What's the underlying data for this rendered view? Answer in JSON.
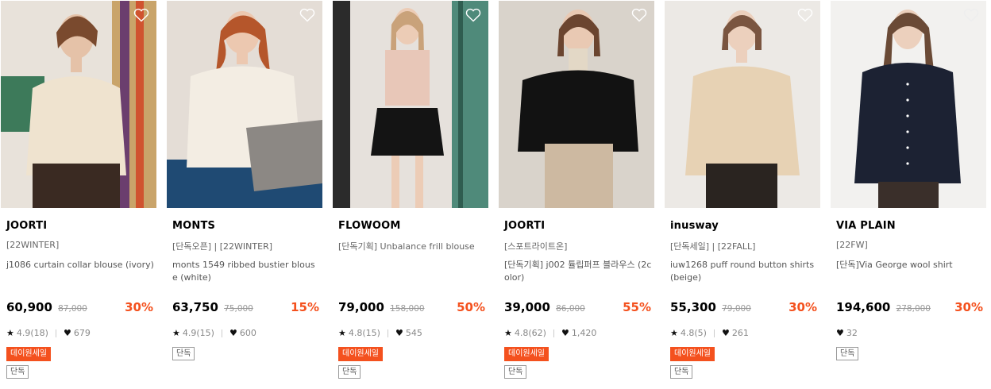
{
  "products": [
    {
      "brand": "JOORTI",
      "tag": "[22WINTER]",
      "name": "j1086 curtain collar blouse (ivory)",
      "price": "60,900",
      "original_price": "87,000",
      "discount": "30%",
      "rating": "4.9(18)",
      "likes": "679",
      "sale_badge": "데이원세일",
      "exclusive_badge": "단독"
    },
    {
      "brand": "MONTS",
      "tag": "[단독오픈] | [22WINTER]",
      "name": "monts 1549 ribbed bustier blouse (white)",
      "price": "63,750",
      "original_price": "75,000",
      "discount": "15%",
      "rating": "4.9(15)",
      "likes": "600",
      "exclusive_badge": "단독"
    },
    {
      "brand": "FLOWOOM",
      "tag": "[단독기획] Unbalance frill blouse",
      "name": "",
      "price": "79,000",
      "original_price": "158,000",
      "discount": "50%",
      "rating": "4.8(15)",
      "likes": "545",
      "sale_badge": "데이원세일",
      "exclusive_badge": "단독"
    },
    {
      "brand": "JOORTI",
      "tag": "[스포트라이트온]",
      "name": "[단독기획] j002 튤립퍼프 블라우스 (2color)",
      "price": "39,000",
      "original_price": "86,000",
      "discount": "55%",
      "rating": "4.8(62)",
      "likes": "1,420",
      "sale_badge": "데이원세일",
      "exclusive_badge": "단독"
    },
    {
      "brand": "inusway",
      "tag": "[단독세일] | [22FALL]",
      "name": "iuw1268 puff round button shirts (beige)",
      "price": "55,300",
      "original_price": "79,000",
      "discount": "30%",
      "rating": "4.8(5)",
      "likes": "261",
      "sale_badge": "데이원세일",
      "exclusive_badge": "단독"
    },
    {
      "brand": "VIA PLAIN",
      "tag": "[22FW]",
      "name": "[단독]Via George wool shirt",
      "price": "194,600",
      "original_price": "278,000",
      "discount": "30%",
      "rating": "",
      "likes": "32",
      "exclusive_badge": "단독"
    }
  ],
  "colors": {
    "accent": "#f4511e",
    "brand_text": "#000000",
    "meta_text": "#666666",
    "strikethrough": "#999999"
  },
  "icons": {
    "wishlist": "heart-outline-icon",
    "rating": "star-icon",
    "likes": "heart-filled-icon"
  }
}
